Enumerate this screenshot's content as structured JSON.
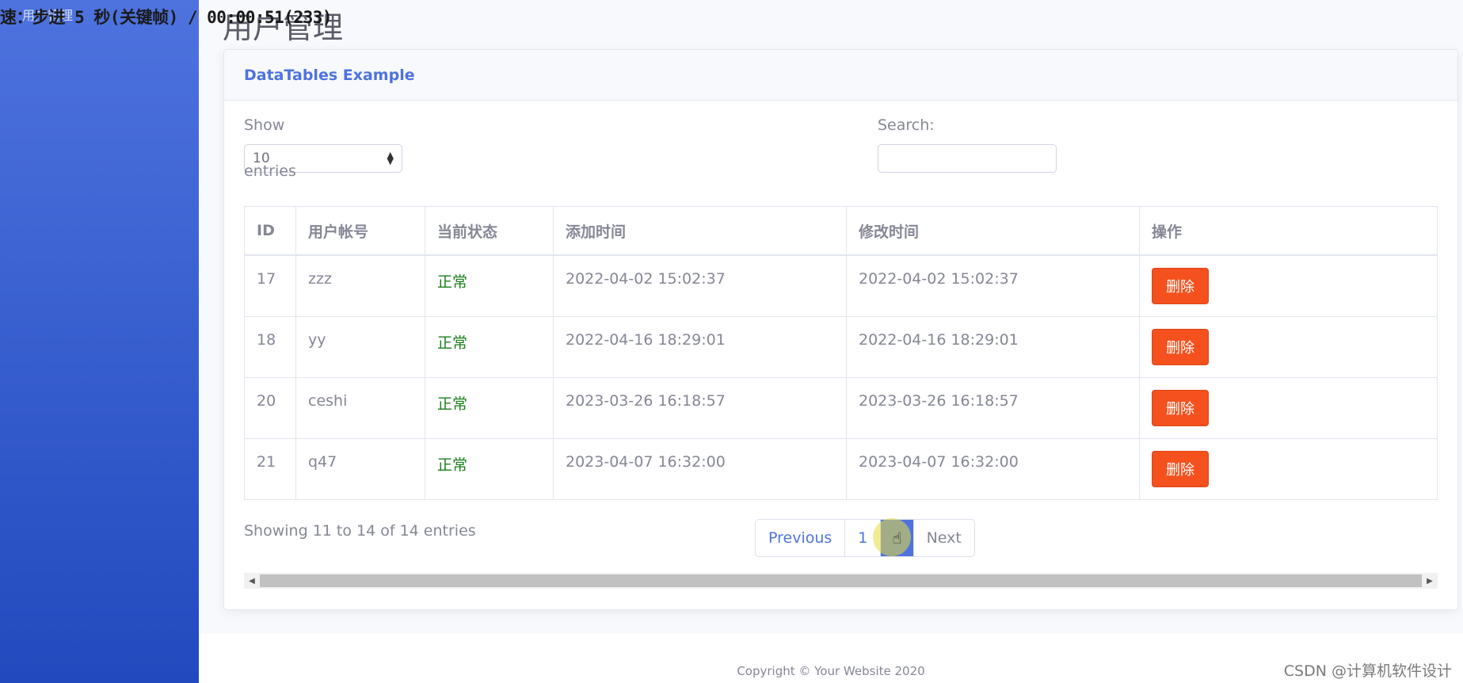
{
  "overlay": {
    "text": "速：步进 5 秒(关键帧) / 00:00:51(233)"
  },
  "sidebar": {
    "brand": "用户管理"
  },
  "page": {
    "title": "用户管理"
  },
  "card": {
    "title": "DataTables Example"
  },
  "controls": {
    "show_label": "Show",
    "entries_value": "10",
    "entries_label": "entries",
    "search_label": "Search:",
    "search_value": ""
  },
  "table": {
    "headers": [
      "ID",
      "用户帐号",
      "当前状态",
      "添加时间",
      "修改时间",
      "操作"
    ],
    "rows": [
      {
        "id": "17",
        "account": "zzz",
        "status": "正常",
        "created": "2022-04-02 15:02:37",
        "modified": "2022-04-02 15:02:37",
        "action": "删除"
      },
      {
        "id": "18",
        "account": "yy",
        "status": "正常",
        "created": "2022-04-16 18:29:01",
        "modified": "2022-04-16 18:29:01",
        "action": "删除"
      },
      {
        "id": "20",
        "account": "ceshi",
        "status": "正常",
        "created": "2023-03-26 16:18:57",
        "modified": "2023-03-26 16:18:57",
        "action": "删除"
      },
      {
        "id": "21",
        "account": "q47",
        "status": "正常",
        "created": "2023-04-07 16:32:00",
        "modified": "2023-04-07 16:32:00",
        "action": "删除"
      }
    ]
  },
  "info": {
    "text": "Showing 11 to 14 of 14 entries"
  },
  "pagination": {
    "previous": "Previous",
    "page1": "1",
    "page2": "2",
    "next": "Next"
  },
  "footer": {
    "copyright": "Copyright © Your Website 2020"
  },
  "watermark": {
    "text": "CSDN @计算机软件设计"
  },
  "colors": {
    "primary": "#4e73df",
    "danger": "#f4511e",
    "success": "#1a7f1a"
  }
}
